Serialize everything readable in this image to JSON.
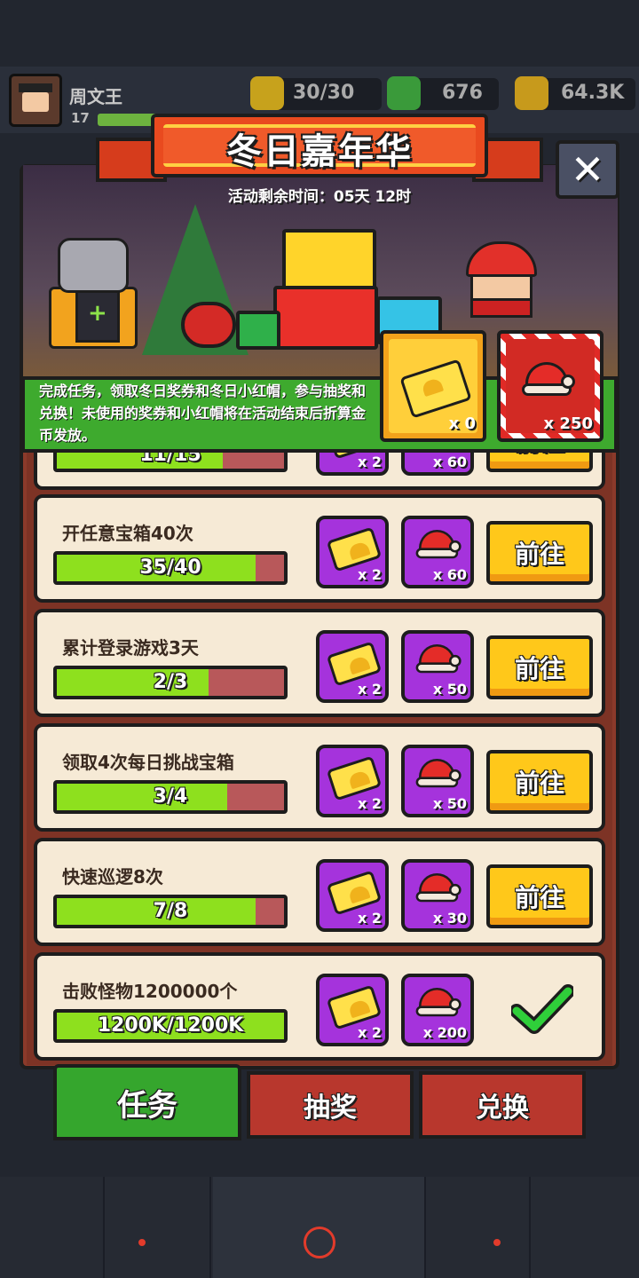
{
  "header": {
    "player_name": "周文王",
    "player_level": "17",
    "energy": "30/30",
    "gems": "676",
    "gold": "64.3K"
  },
  "event": {
    "title": "冬日嘉年华",
    "time_remaining": "活动剩余时间：05天 12时",
    "description": "完成任务，领取冬日奖券和冬日小红帽，参与抽奖和兑换！未使用的奖券和小红帽将在活动结束后折算金币发放。",
    "ticket_count": "x 0",
    "hat_count": "x 250"
  },
  "tasks": [
    {
      "title": "",
      "progress_text": "11/15",
      "progress": 0.73,
      "ticket_reward": "x 2",
      "hat_reward": "x 60",
      "action": "前往",
      "completed": false
    },
    {
      "title": "开任意宝箱40次",
      "progress_text": "35/40",
      "progress": 0.875,
      "ticket_reward": "x 2",
      "hat_reward": "x 60",
      "action": "前往",
      "completed": false
    },
    {
      "title": "累计登录游戏3天",
      "progress_text": "2/3",
      "progress": 0.667,
      "ticket_reward": "x 2",
      "hat_reward": "x 50",
      "action": "前往",
      "completed": false
    },
    {
      "title": "领取4次每日挑战宝箱",
      "progress_text": "3/4",
      "progress": 0.75,
      "ticket_reward": "x 2",
      "hat_reward": "x 50",
      "action": "前往",
      "completed": false
    },
    {
      "title": "快速巡逻8次",
      "progress_text": "7/8",
      "progress": 0.875,
      "ticket_reward": "x 2",
      "hat_reward": "x 30",
      "action": "前往",
      "completed": false
    },
    {
      "title": "击败怪物1200000个",
      "progress_text": "1200K/1200K",
      "progress": 1.0,
      "ticket_reward": "x 2",
      "hat_reward": "x 200",
      "action": "",
      "completed": true
    }
  ],
  "tabs": [
    {
      "label": "任务",
      "active": true
    },
    {
      "label": "抽奖",
      "active": false
    },
    {
      "label": "兑换",
      "active": false
    }
  ],
  "colors": {
    "panel": "#8b3a2a",
    "row": "#f6ead6",
    "progress_fill": "#8ee01e",
    "go_button": "#ffc81a",
    "reward_bg": "#a533dc",
    "tab_active": "#35a62d",
    "tab_inactive": "#b8372d"
  }
}
